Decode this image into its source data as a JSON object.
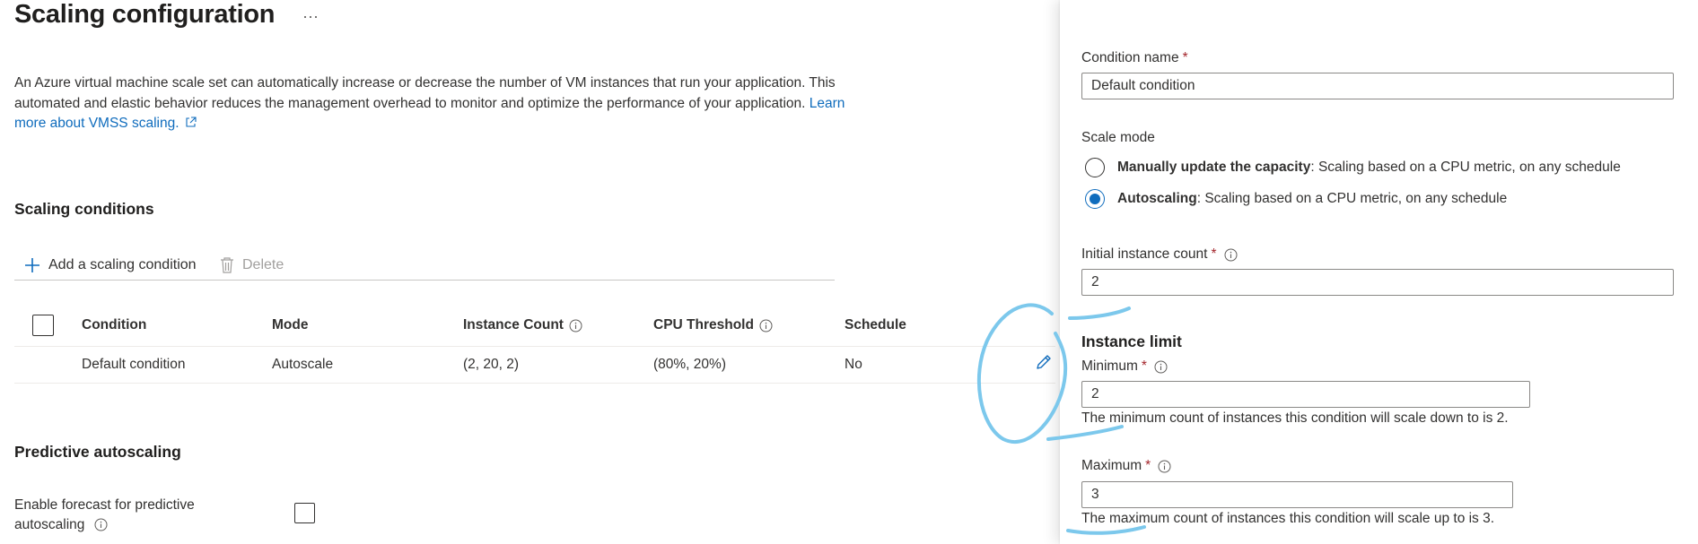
{
  "page": {
    "title": "Scaling configuration",
    "more_label": "···",
    "description": "An Azure virtual machine scale set can automatically increase or decrease the number of VM instances that run your application. This automated and elastic behavior reduces the management overhead to monitor and optimize the performance of your application.",
    "learn_more": "Learn more about VMSS scaling."
  },
  "scaling_conditions": {
    "title": "Scaling conditions",
    "add_label": "Add a scaling condition",
    "delete_label": "Delete",
    "columns": [
      "Condition",
      "Mode",
      "Instance Count",
      "CPU Threshold",
      "Schedule"
    ],
    "rows": [
      {
        "condition": "Default condition",
        "mode": "Autoscale",
        "instance_count": "(2, 20, 2)",
        "cpu_threshold": "(80%, 20%)",
        "schedule": "No"
      }
    ]
  },
  "predictive": {
    "title": "Predictive autoscaling",
    "forecast_label": "Enable forecast for predictive autoscaling",
    "checked": false
  },
  "panel": {
    "condition_name_label": "Condition name",
    "condition_name_value": "Default condition",
    "scale_mode_label": "Scale mode",
    "mode_manual_bold": "Manually update the capacity",
    "mode_manual_desc": ": Scaling based on a CPU metric, on any schedule",
    "mode_auto_bold": "Autoscaling",
    "mode_auto_desc": ": Scaling based on a CPU metric, on any schedule",
    "selected_mode": "autoscaling",
    "initial_count_label": "Initial instance count",
    "initial_count_value": "2",
    "instance_limit_title": "Instance limit",
    "minimum_label": "Minimum",
    "minimum_value": "2",
    "minimum_help": "The minimum count of instances this condition will scale down to is 2.",
    "maximum_label": "Maximum",
    "maximum_value": "3",
    "maximum_help": "The maximum count of instances this condition will scale up to is 3.",
    "required_marker": "*"
  },
  "colors": {
    "link": "#0f6cbd",
    "required": "#a4262c",
    "ink_annotation": "#7cc8ec"
  },
  "icons": [
    "plus-icon",
    "trash-icon",
    "info-icon",
    "edit-pencil-icon",
    "external-link-icon"
  ]
}
